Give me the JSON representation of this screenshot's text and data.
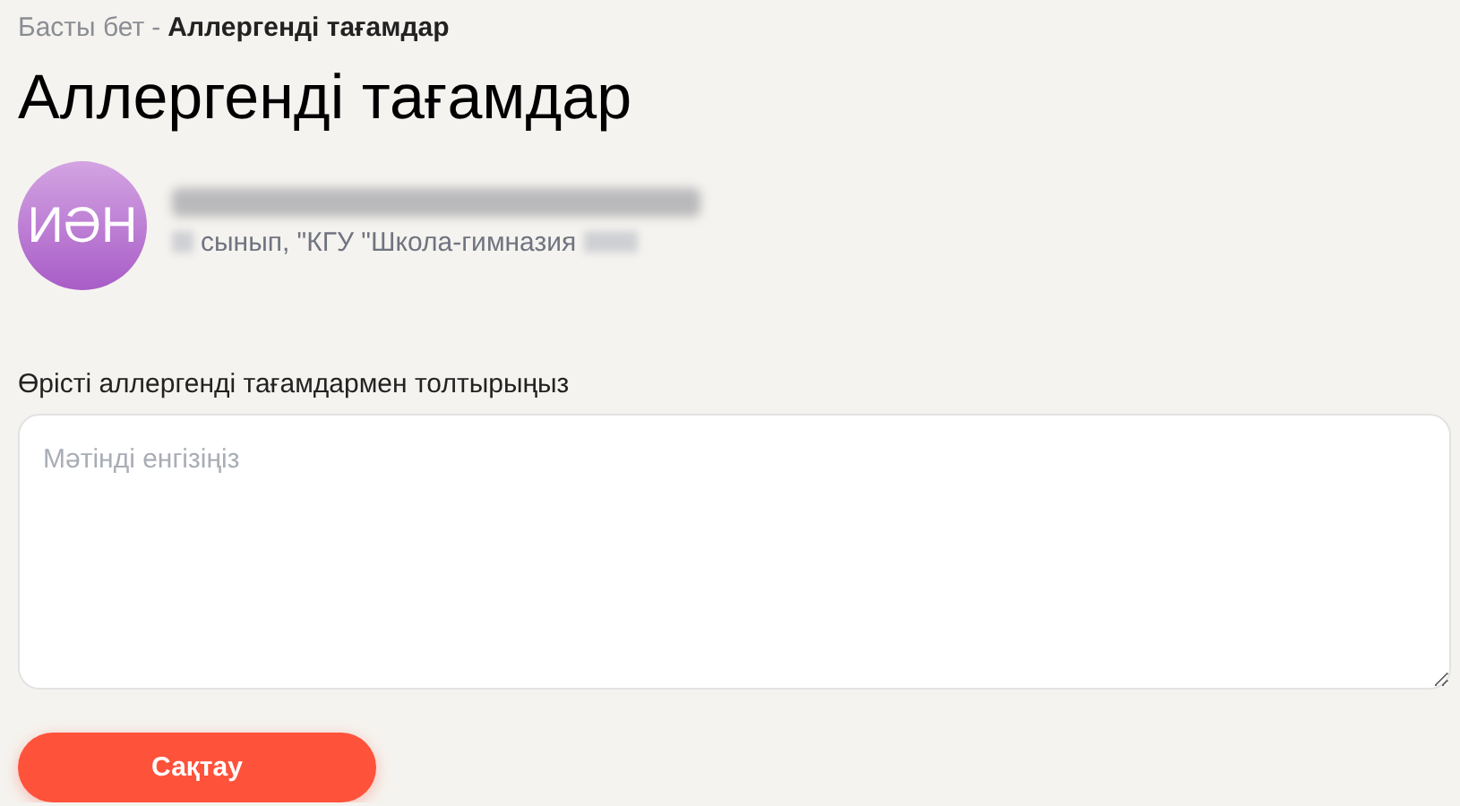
{
  "breadcrumb": {
    "home": "Басты бет",
    "separator": "-",
    "current": "Аллергенді тағамдар"
  },
  "title": "Аллергенді тағамдар",
  "profile": {
    "initials": "ИӘН",
    "school": "сынып, \"КГУ \"Школа-гимназия"
  },
  "form": {
    "label": "Өрісті аллергенді тағамдармен толтырыңыз",
    "placeholder": "Мәтінді енгізіңіз",
    "button": "Сақтау"
  }
}
